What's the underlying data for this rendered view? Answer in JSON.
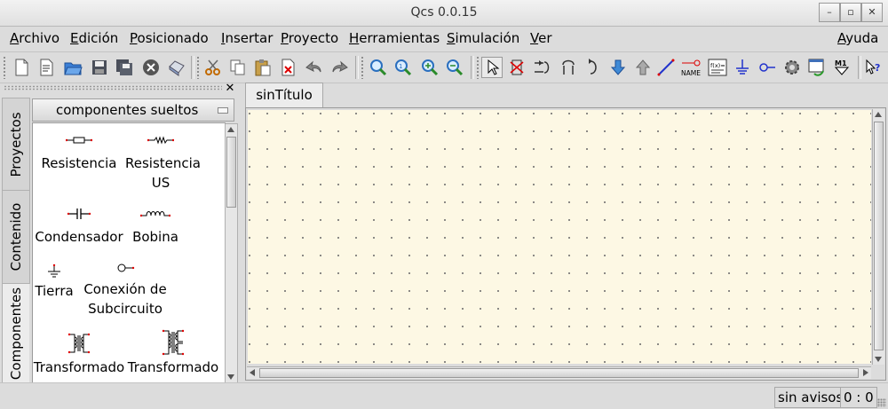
{
  "window": {
    "title": "Qcs 0.0.15",
    "minimize_label": "–",
    "maximize_label": "▫",
    "close_label": "✕"
  },
  "menu": {
    "archivo": "Archivo",
    "edicion": "Edición",
    "posicionado": "Posicionado",
    "insertar": "Insertar",
    "proyecto": "Proyecto",
    "herramientas": "Herramientas",
    "simulacion": "Simulación",
    "ver": "Ver",
    "ayuda": "Ayuda"
  },
  "toolbar": {
    "icons": [
      "new-file",
      "new-text",
      "open",
      "save",
      "save-all",
      "close",
      "print",
      "cut",
      "copy",
      "paste",
      "delete",
      "undo",
      "redo",
      "zoom-fit",
      "zoom-1to1",
      "zoom-in",
      "zoom-out",
      "select",
      "edit-activate",
      "mirror-x",
      "mirror-y",
      "rotate",
      "go-into-subcircuit",
      "pop-out",
      "insert-wire",
      "insert-label",
      "insert-equation",
      "insert-ground",
      "insert-port",
      "simulate",
      "view-data",
      "marker",
      "whats-this"
    ],
    "label_name": "NAME",
    "equation_text": "f(x)=",
    "marker_text": "M1"
  },
  "dock": {
    "close_label": "✕",
    "tabs": [
      "Proyectos",
      "Contenido",
      "Componentes"
    ],
    "active_tab": "Componentes",
    "category": "componentes sueltos",
    "components": [
      {
        "label": "Resistencia",
        "icon": "resistor-icon"
      },
      {
        "label": "Resistencia US",
        "icon": "resistor-us-icon"
      },
      {
        "label": "Condensador",
        "icon": "capacitor-icon"
      },
      {
        "label": "Bobina",
        "icon": "inductor-icon"
      },
      {
        "label": "Tierra",
        "icon": "ground-icon"
      },
      {
        "label": "Conexión de Subcircuito",
        "icon": "subcircuit-port-icon"
      },
      {
        "label": "Transformado",
        "icon": "transformer-icon"
      },
      {
        "label": "Transformado",
        "icon": "symmetric-transformer-icon"
      }
    ]
  },
  "document": {
    "tab_title": "sinTítulo",
    "grid_color": "#fdf8e4"
  },
  "status": {
    "message": "sin avisos",
    "position": "0 : 0"
  }
}
